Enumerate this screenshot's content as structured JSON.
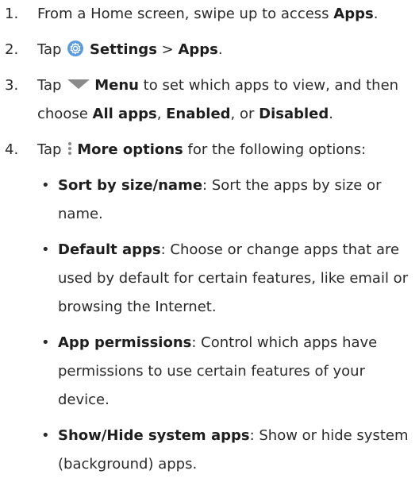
{
  "steps": [
    {
      "num": "1.",
      "pre": "From a Home screen, swipe up to access ",
      "bold": "Apps",
      "post": "."
    },
    {
      "num": "2.",
      "pre": "Tap ",
      "icon": "settings-icon",
      "bold1": "Settings",
      "sep": " > ",
      "bold2": "Apps",
      "post": "."
    },
    {
      "num": "3.",
      "pre": "Tap ",
      "icon": "menu-triangle-icon",
      "bold1": "Menu",
      "mid": " to set which apps to view, and then choose ",
      "bold2": "All apps",
      "comma": ", ",
      "bold3": "Enabled",
      "or": ", or ",
      "bold4": "Disabled",
      "post": "."
    },
    {
      "num": "4.",
      "pre": "Tap ",
      "icon": "more-options-icon",
      "bold1": "More options",
      "post": " for the following options:",
      "options": [
        {
          "label": "Sort by size/name",
          "desc": ": Sort the apps by size or name."
        },
        {
          "label": "Default apps",
          "desc": ": Choose or change apps that are used by default for certain features, like email or browsing the Internet."
        },
        {
          "label": "App permissions",
          "desc": ": Control which apps have permissions to use certain features of your device."
        },
        {
          "label": "Show/Hide system apps",
          "desc": ": Show or hide system (background) apps."
        }
      ]
    }
  ],
  "colors": {
    "text": "#2a2a2a",
    "settings_icon": "#5a9be0",
    "glyph_gray": "#8a8a8a"
  }
}
